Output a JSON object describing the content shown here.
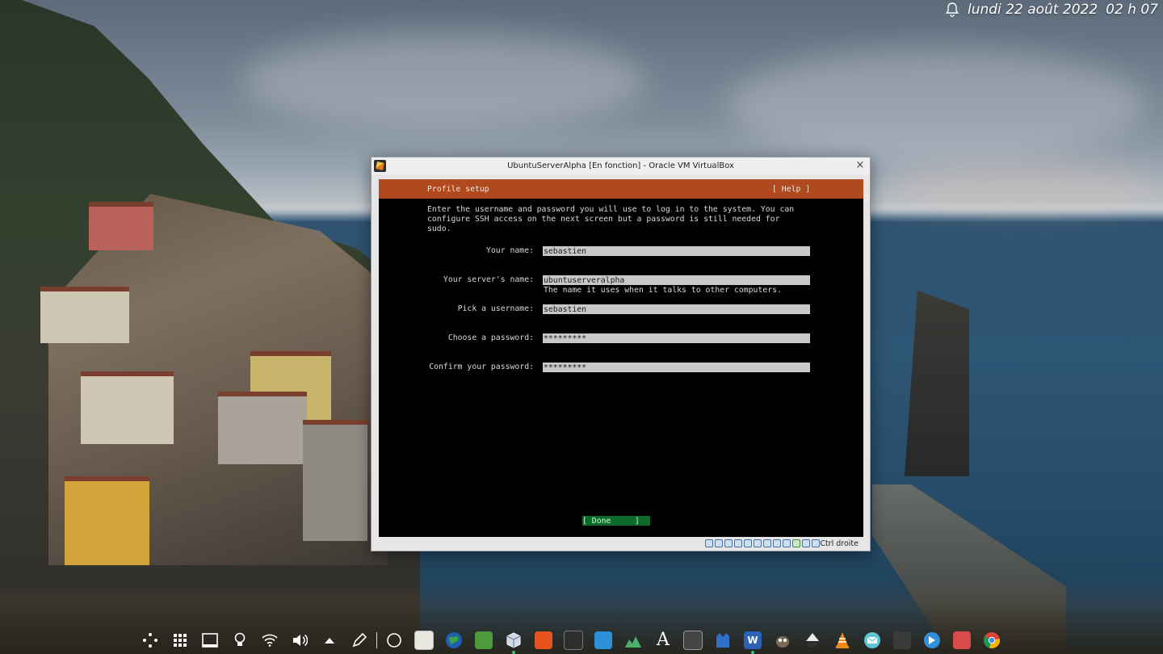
{
  "topbar": {
    "date": "lundi 22 août 2022",
    "time": "02 h 07"
  },
  "vbox": {
    "window_title": "UbuntuServerAlpha [En fonction] - Oracle VM VirtualBox",
    "close_glyph": "×",
    "host_key": "Ctrl droite"
  },
  "installer": {
    "section_title": "Profile setup",
    "help_label": "[ Help ]",
    "intro": "Enter the username and password you will use to log in to the system. You can\nconfigure SSH access on the next screen but a password is still needed for\nsudo.",
    "fields": [
      {
        "label": "Your name:",
        "value": "sebastien",
        "hint": ""
      },
      {
        "label": "Your server's name:",
        "value": "ubuntuserveralpha",
        "hint": "The name it uses when it talks to other computers."
      },
      {
        "label": "Pick a username:",
        "value": "sebastien",
        "hint": ""
      },
      {
        "label": "Choose a password:",
        "value": "*********",
        "hint": ""
      },
      {
        "label": "Confirm your password:",
        "value": "*********",
        "hint": ""
      }
    ],
    "done_label": "[ Done     ]"
  },
  "colors": {
    "header_orange": "#b04a1e",
    "done_green": "#0c6b28",
    "field_gray": "#c8c8c8"
  },
  "dock": {
    "items": [
      "apps-launcher-icon",
      "app-grid-icon",
      "desktop-icon",
      "lightbulb-icon",
      "wifi-icon",
      "volume-icon",
      "tray-up-arrow-icon",
      "pen-icon",
      "circle-icon",
      "text-editor-icon",
      "earth-icon",
      "archive-icon",
      "virtualbox-icon",
      "ubuntu-icon",
      "terminal-icon",
      "screenshot-icon",
      "system-monitor-icon",
      "font-viewer-icon",
      "calculator-icon",
      "kate-icon",
      "word-icon",
      "gimp-icon",
      "inkscape-icon",
      "vlc-icon",
      "mail-icon",
      "console-icon",
      "kdeconnect-icon",
      "files-icon",
      "chrome-icon"
    ],
    "word_letter": "W",
    "font_letter": "A"
  }
}
